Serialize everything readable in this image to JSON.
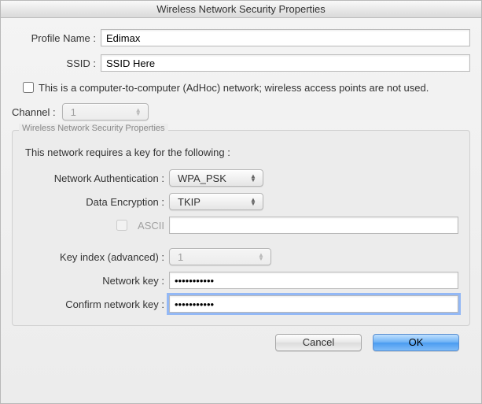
{
  "window": {
    "title": "Wireless Network Security Properties"
  },
  "profile": {
    "name_label": "Profile Name :",
    "name_value": "Edimax",
    "ssid_label": "SSID :",
    "ssid_value": "SSID Here"
  },
  "adhoc": {
    "label": "This is a computer-to-computer (AdHoc) network; wireless access points are not used.",
    "checked": false
  },
  "channel": {
    "label": "Channel :",
    "value": "1",
    "enabled": false
  },
  "group": {
    "legend": "Wireless Network Security Properties",
    "intro": "This network requires a key for the following :",
    "auth_label": "Network Authentication :",
    "auth_value": "WPA_PSK",
    "enc_label": "Data Encryption :",
    "enc_value": "TKIP",
    "ascii_label": "ASCII",
    "ascii_checked": false,
    "ascii_enabled": false,
    "ascii_text_value": "",
    "key_index_label": "Key index (advanced) :",
    "key_index_value": "1",
    "key_index_enabled": false,
    "netkey_label": "Network key :",
    "netkey_value": "•••••••••••",
    "confirm_label": "Confirm network key :",
    "confirm_value": "•••••••••••"
  },
  "buttons": {
    "cancel": "Cancel",
    "ok": "OK"
  }
}
